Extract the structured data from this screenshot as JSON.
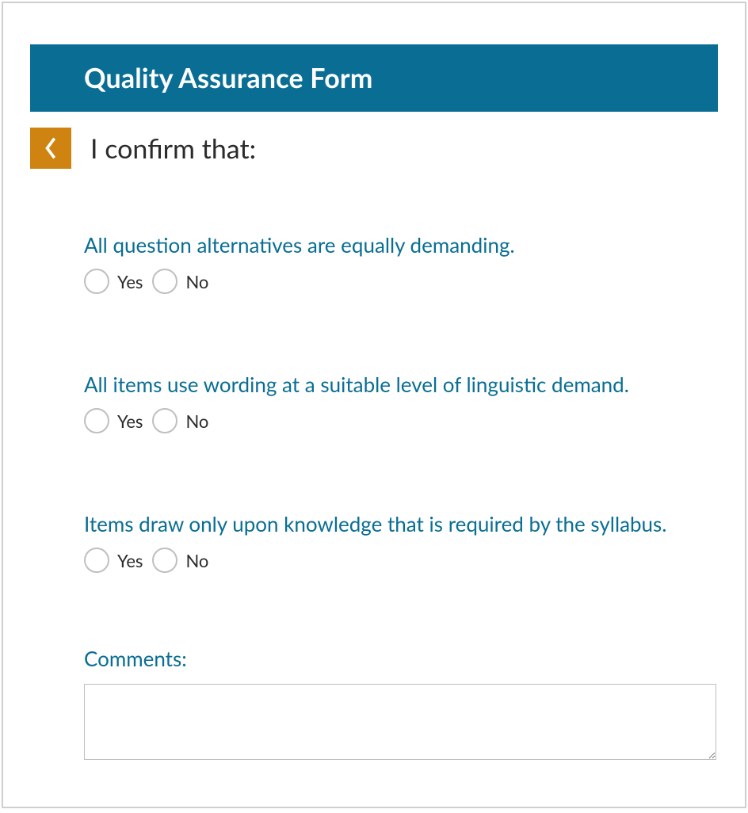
{
  "header": {
    "title": "Quality Assurance Form"
  },
  "section": {
    "title": "I confirm that:"
  },
  "questions": [
    {
      "text": "All question alternatives are equally demanding.",
      "options": {
        "yes": "Yes",
        "no": "No"
      }
    },
    {
      "text": "All items use wording at a suitable level of linguistic demand.",
      "options": {
        "yes": "Yes",
        "no": "No"
      }
    },
    {
      "text": "Items draw only upon knowledge that is required by the syllabus.",
      "options": {
        "yes": "Yes",
        "no": "No"
      }
    }
  ],
  "comments": {
    "label": "Comments:",
    "value": ""
  }
}
